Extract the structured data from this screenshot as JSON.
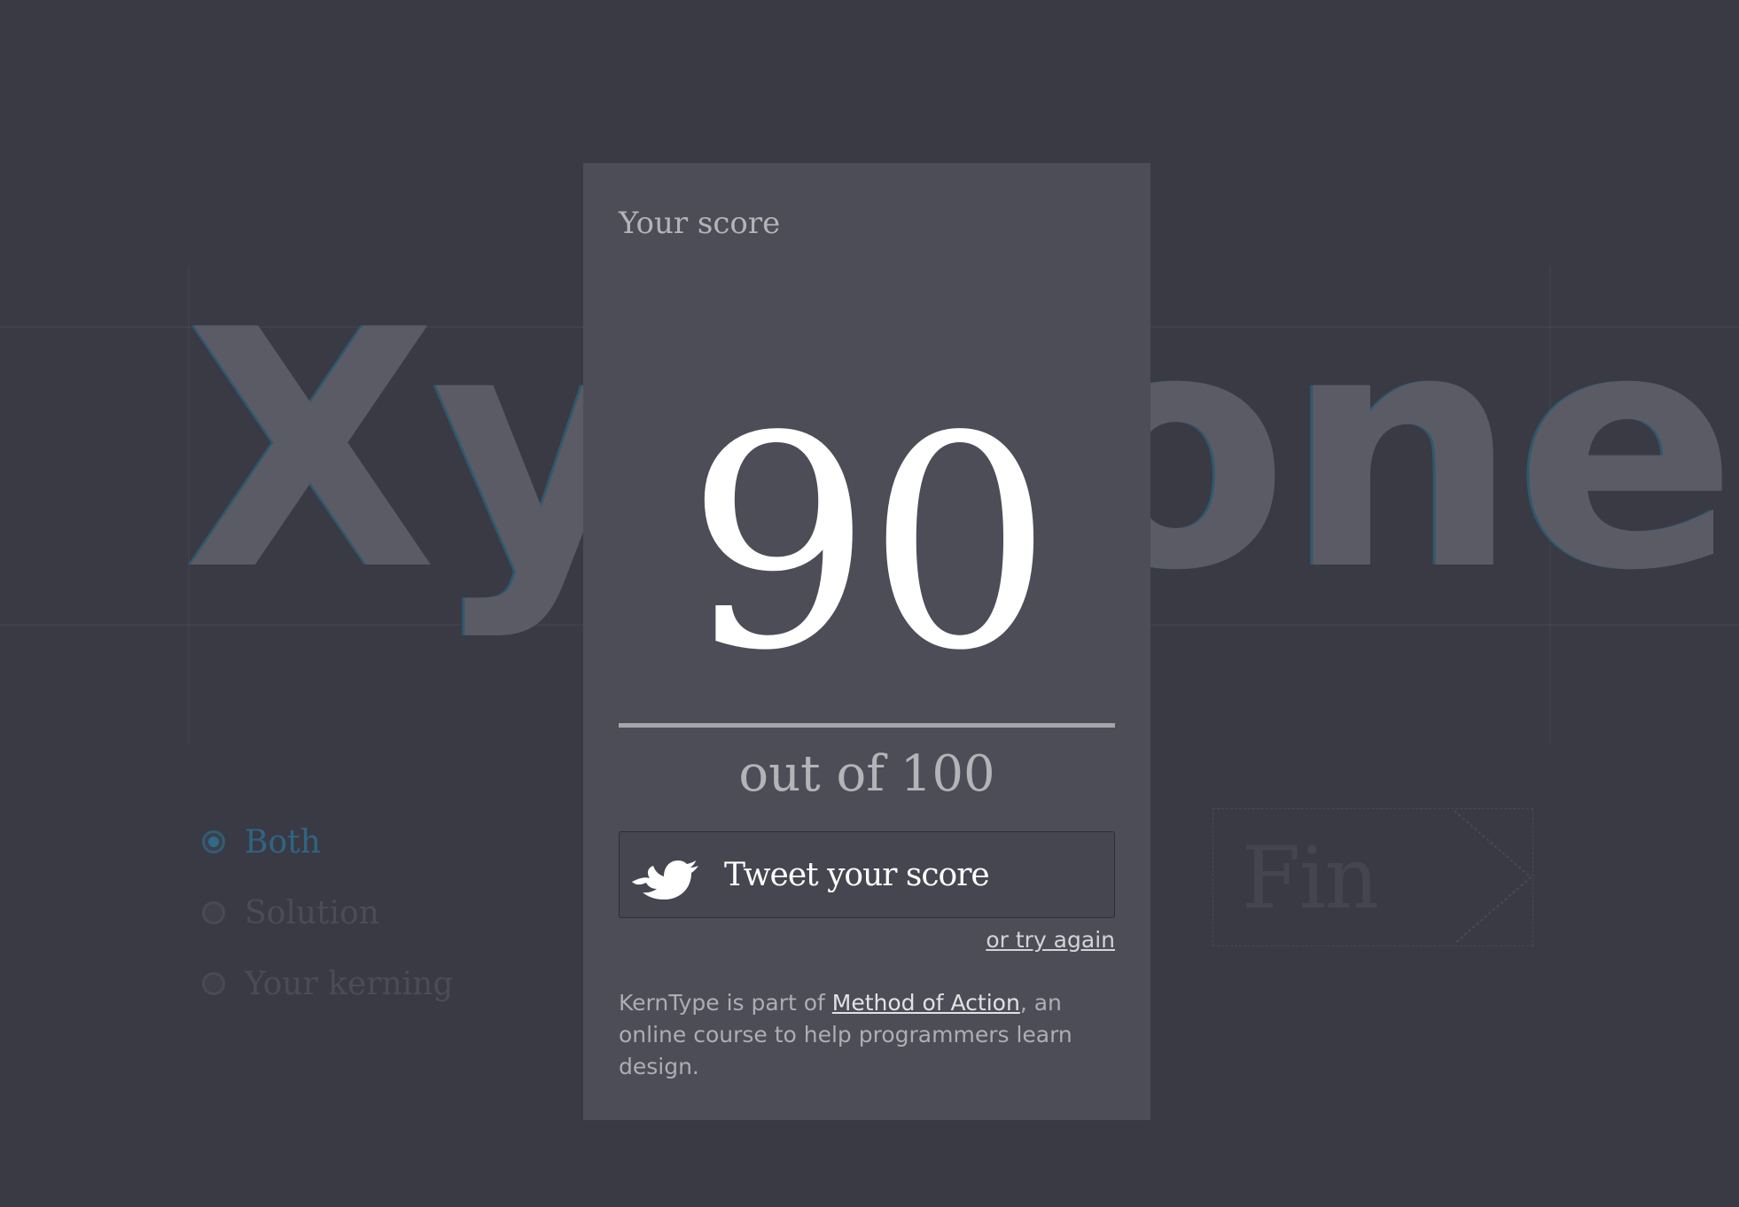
{
  "background": {
    "word_left": "Xyl",
    "word_right": "one",
    "modes": [
      {
        "label": "Both",
        "selected": true
      },
      {
        "label": "Solution",
        "selected": false
      },
      {
        "label": "Your kerning",
        "selected": false
      }
    ],
    "finish_label": "Fin"
  },
  "modal": {
    "title": "Your score",
    "score": "90",
    "out_of": "out of 100",
    "tweet_label": "Tweet your score",
    "try_again": "or try again",
    "footer_prefix": "KernType is part of ",
    "footer_link": "Method of Action",
    "footer_suffix": ", an online course to help programmers learn design."
  },
  "icons": {
    "tweet": "twitter-bird-icon",
    "finish": "arrow-right-icon"
  },
  "colors": {
    "page_background": "#3a3a45",
    "modal_background": "#4d4d58",
    "accent_blue": "#2e6583",
    "score_text": "#ffffff"
  }
}
